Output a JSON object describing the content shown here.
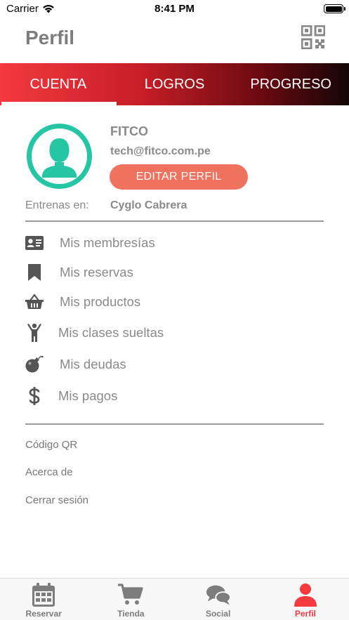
{
  "status_bar": {
    "carrier": "Carrier",
    "time": "8:41 PM"
  },
  "header": {
    "title": "Perfil",
    "qr_icon": "qr-code-icon"
  },
  "tabs": [
    {
      "label": "CUENTA",
      "active": true
    },
    {
      "label": "LOGROS",
      "active": false
    },
    {
      "label": "PROGRESO",
      "active": false
    }
  ],
  "profile": {
    "name": "FITCO",
    "email": "tech@fitco.com.pe",
    "edit_label": "EDITAR PERFIL",
    "gym_label": "Entrenas en:",
    "gym_name": "Cyglo Cabrera"
  },
  "menu": [
    {
      "label": "Mis membresías",
      "icon": "id-card-icon"
    },
    {
      "label": "Mis reservas",
      "icon": "bookmark-icon"
    },
    {
      "label": "Mis productos",
      "icon": "basket-icon"
    },
    {
      "label": "Mis clases sueltas",
      "icon": "person-raised-arms-icon"
    },
    {
      "label": "Mis deudas",
      "icon": "bomb-icon"
    },
    {
      "label": "Mis pagos",
      "icon": "dollar-icon"
    }
  ],
  "links": [
    {
      "label": "Código QR"
    },
    {
      "label": "Acerca de"
    },
    {
      "label": "Cerrar sesión"
    }
  ],
  "tabbar": [
    {
      "label": "Reservar",
      "icon": "calendar-icon",
      "active": false
    },
    {
      "label": "Tienda",
      "icon": "cart-icon",
      "active": false
    },
    {
      "label": "Social",
      "icon": "chat-bubbles-icon",
      "active": false
    },
    {
      "label": "Perfil",
      "icon": "person-icon",
      "active": true
    }
  ],
  "colors": {
    "accent": "#f23a3f",
    "avatar_ring": "#25c6a3",
    "edit_button": "#ef725e",
    "text_gray": "#8a8a8a",
    "icon_gray": "#555555"
  }
}
